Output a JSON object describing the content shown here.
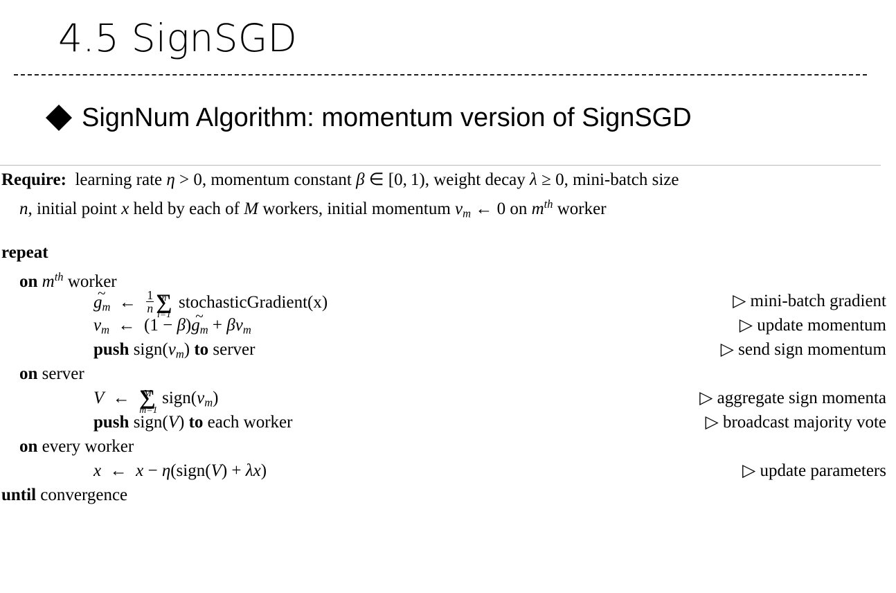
{
  "slide": {
    "title": "4.5 SignSGD",
    "bullet_glyph": "black-diamond",
    "bullet_text": "SignNum Algorithm: momentum version of SignSGD"
  },
  "algorithm": {
    "require_label": "Require:",
    "require_line1": "learning rate η > 0, momentum constant β ∈ [0, 1), weight decay λ ≥ 0, mini-batch size",
    "require_line2": "n, initial point x held by each of M workers, initial momentum v_m ← 0 on mᵗʰ worker",
    "repeat_label": "repeat",
    "until_label": "until",
    "until_condition": "convergence",
    "lines": [
      {
        "keyword": "on",
        "code": "on m^th worker",
        "comment": ""
      },
      {
        "code": "g̃_m ← (1/n) Σ_{i=1}^{n} stochasticGradient(x)",
        "comment": "▷ mini-batch gradient"
      },
      {
        "code": "v_m ← (1 − β)g̃_m + βv_m",
        "comment": "▷ update momentum"
      },
      {
        "keyword": "push",
        "code": "push sign(v_m) to server",
        "comment": "▷ send sign momentum"
      },
      {
        "keyword": "on",
        "code": "on server",
        "comment": ""
      },
      {
        "code": "V ← Σ_{m=1}^{M} sign(v_m)",
        "comment": "▷ aggregate sign momenta"
      },
      {
        "keyword": "push",
        "code": "push sign(V) to each worker",
        "comment": "▷ broadcast majority vote"
      },
      {
        "keyword": "on",
        "code": "on every worker",
        "comment": ""
      },
      {
        "code": "x ← x − η(sign(V) + λx)",
        "comment": "▷ update parameters"
      }
    ],
    "comments": {
      "mini_batch_gradient": "▷ mini-batch gradient",
      "update_momentum": "▷ update momentum",
      "send_sign_momentum": "▷ send sign momentum",
      "aggregate_sign_momenta": "▷ aggregate sign momenta",
      "broadcast_majority_vote": "▷ broadcast majority vote",
      "update_parameters": "▷ update parameters"
    },
    "tokens": {
      "on": "on",
      "push": "push",
      "to": "to",
      "server_word": "server",
      "worker_word": "worker",
      "every_word": "every",
      "each_worker": "each worker",
      "sign": "sign",
      "stochastic_gradient": "stochasticGradient",
      "learning_rate_text": "learning rate",
      "momentum_constant_text": "momentum constant",
      "weight_decay_text": "weight decay",
      "mini_batch_size_text": "mini-batch size",
      "initial_point_text": "initial point",
      "held_by_each_of_text": "held by each of",
      "workers_text": "workers,",
      "initial_momentum_text": "initial momentum",
      "on_text": "on",
      "eta": "η",
      "beta": "β",
      "lambda": "λ",
      "sigma": "Σ",
      "arrow": "←",
      "gt": ">",
      "geq": "≥",
      "in": "∈",
      "minus": "−",
      "plus": "+",
      "zero": "0",
      "one": "1",
      "interval": "[0, 1),",
      "comma": ",",
      "th": "th"
    }
  },
  "colors": {
    "background": "#ffffff",
    "text": "#000000",
    "title_rule": "#1a1a1a",
    "algo_rule": "#b9b9b9"
  }
}
